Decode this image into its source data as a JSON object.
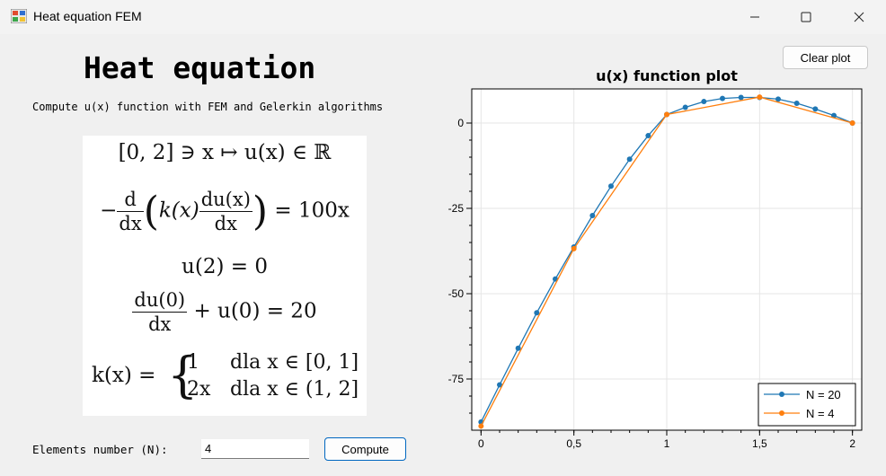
{
  "window": {
    "title": "Heat equation FEM",
    "minimize_icon": "minimize-icon",
    "maximize_icon": "maximize-icon",
    "close_icon": "close-icon"
  },
  "left": {
    "heading": "Heat equation",
    "subtitle": "Compute u(x) function with FEM and Gelerkin algorithms",
    "formula": {
      "line1": "[0, 2] ∋ x ↦ u(x) ∈ ℝ",
      "line2_prefix": "−",
      "line2_d": "d",
      "line2_dx": "dx",
      "line2_k": "k(x)",
      "line2_du": "du(x)",
      "line2_dx2": "dx",
      "line2_rhs": "= 100x",
      "line3": "u(2) = 0",
      "line4_num": "du(0)",
      "line4_den": "dx",
      "line4_rhs": "+ u(0) = 20",
      "line5_lhs": "k(x) =",
      "case1_val": "1",
      "case1_cond": "dla x ∈ [0, 1]",
      "case2_val": "2x",
      "case2_cond": "dla x ∈ (1, 2]"
    },
    "elements_label": "Elements number (N):",
    "elements_value": "4",
    "compute_label": "Compute"
  },
  "right": {
    "clear_label": "Clear plot"
  },
  "chart_data": {
    "type": "line",
    "title": "u(x) function plot",
    "xlabel": "",
    "ylabel": "",
    "xlim": [
      -0.05,
      2.05
    ],
    "ylim": [
      -90,
      10
    ],
    "x_ticks": [
      0,
      0.5,
      1,
      1.5,
      2
    ],
    "x_tick_labels": [
      "0",
      "0,5",
      "1",
      "1,5",
      "2"
    ],
    "y_ticks": [
      0,
      -25,
      -50,
      -75
    ],
    "y_tick_labels": [
      "0",
      "-25",
      "-50",
      "-75"
    ],
    "grid": true,
    "legend_position": "bottom-right",
    "series": [
      {
        "name": "N = 20",
        "color": "#1f77b4",
        "x": [
          0,
          0.1,
          0.2,
          0.3,
          0.4,
          0.5,
          0.6,
          0.7,
          0.8,
          0.9,
          1.0,
          1.1,
          1.2,
          1.3,
          1.4,
          1.5,
          1.6,
          1.7,
          1.8,
          1.9,
          2.0
        ],
        "y": [
          -87.6,
          -76.7,
          -66.0,
          -55.6,
          -45.7,
          -36.3,
          -27.1,
          -18.5,
          -10.6,
          -3.7,
          2.5,
          4.6,
          6.3,
          7.2,
          7.5,
          7.5,
          7.0,
          5.8,
          4.1,
          2.2,
          0.0
        ]
      },
      {
        "name": "N = 4",
        "color": "#ff7f0e",
        "x": [
          0,
          0.5,
          1.0,
          1.5,
          2.0
        ],
        "y": [
          -88.8,
          -36.8,
          2.5,
          7.6,
          0.0
        ]
      }
    ]
  }
}
